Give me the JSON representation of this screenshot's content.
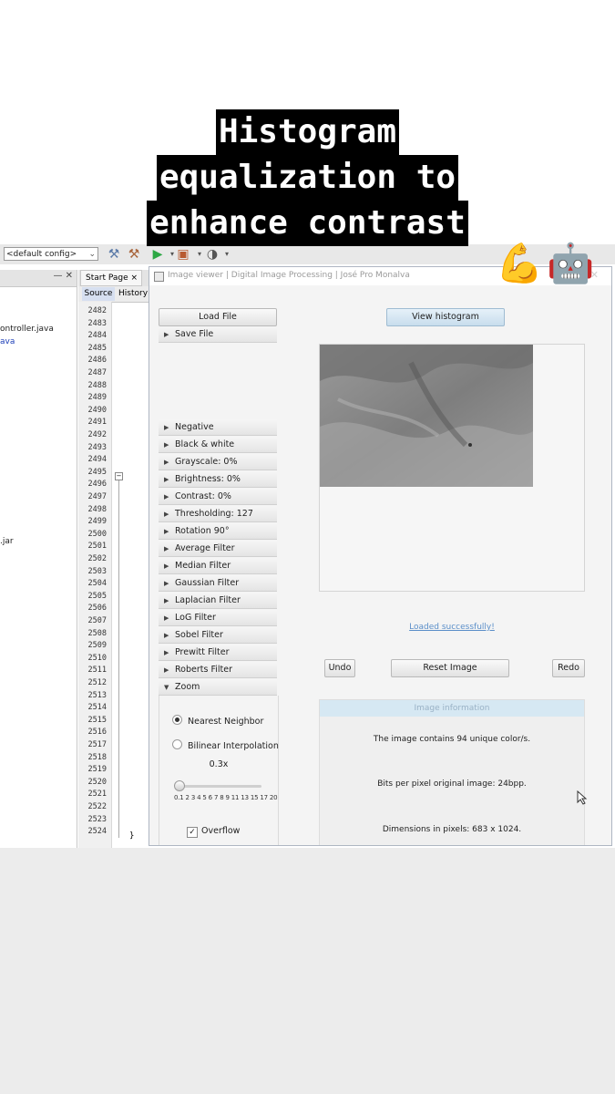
{
  "caption": {
    "lines": [
      "Histogram",
      "equalization to",
      "enhance contrast"
    ],
    "emoji_arm": "💪",
    "emoji_robot": "🤖"
  },
  "ide": {
    "config_select": "<default config>",
    "project_files": [
      "ontroller.java",
      "ava",
      ".jar"
    ],
    "editor_tab": "Start Page",
    "editor_tab_close": "×",
    "subtabs": {
      "source": "Source",
      "history": "History"
    },
    "line_numbers": [
      "2482",
      "2483",
      "2484",
      "2485",
      "2486",
      "2487",
      "2488",
      "2489",
      "2490",
      "2491",
      "2492",
      "2493",
      "2494",
      "2495",
      "2496",
      "2497",
      "2498",
      "2499",
      "2500",
      "2501",
      "2502",
      "2503",
      "2504",
      "2505",
      "2506",
      "2507",
      "2508",
      "2509",
      "2510",
      "2511",
      "2512",
      "2513",
      "2514",
      "2515",
      "2516",
      "2517",
      "2518",
      "2519",
      "2520",
      "2521",
      "2522",
      "2523",
      "2524"
    ],
    "closing_brace": "}"
  },
  "app": {
    "title": "Image viewer | Digital Image Processing | José Pro Monalva",
    "load_file": "Load File",
    "save_file": "Save File",
    "view_histogram": "View histogram",
    "filters": [
      "Negative",
      "Black & white",
      "Grayscale: 0%",
      "Brightness: 0%",
      "Contrast: 0%",
      "Thresholding: 127",
      "Rotation 90°",
      "Average Filter",
      "Median Filter",
      "Gaussian Filter",
      "Laplacian Filter",
      "LoG Filter",
      "Sobel Filter",
      "Prewitt Filter",
      "Roberts Filter"
    ],
    "zoom": {
      "label": "Zoom",
      "nearest_neighbor": "Nearest Neighbor",
      "bilinear": "Bilinear Interpolation",
      "value": "0.3x",
      "slider_fraction": 0.0,
      "ticks": "0.1 2 3 4 5 6 7 8 9  11 13 15 17  20",
      "overflow": "Overflow"
    },
    "status": "Loaded successfully!",
    "undo": "Undo",
    "reset": "Reset Image",
    "redo": "Redo",
    "info": {
      "header": "Image information",
      "unique_colors": "The image contains 94 unique color/s.",
      "bits_per_pixel": "Bits per pixel original image: 24bpp.",
      "dimensions": "Dimensions in pixels: 683 x 1024."
    }
  }
}
